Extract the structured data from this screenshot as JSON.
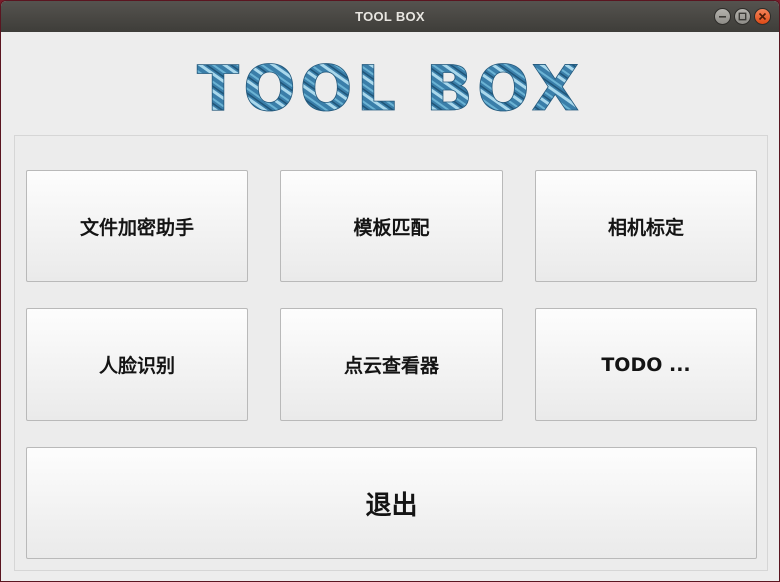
{
  "window": {
    "title": "TOOL BOX",
    "controls": [
      "minimize-icon",
      "maximize-icon",
      "close-icon"
    ]
  },
  "banner": {
    "text": "TOOL BOX",
    "colors": [
      "#2f6f9a",
      "#6fb4d6",
      "#9ad0e6"
    ]
  },
  "buttons": {
    "file_encrypt": "文件加密助手",
    "template_match": "模板匹配",
    "camera_calib": "相机标定",
    "face_recog": "人脸识别",
    "pointcloud_viewer": "点云查看器",
    "todo": "TODO ...",
    "exit": "退出"
  }
}
